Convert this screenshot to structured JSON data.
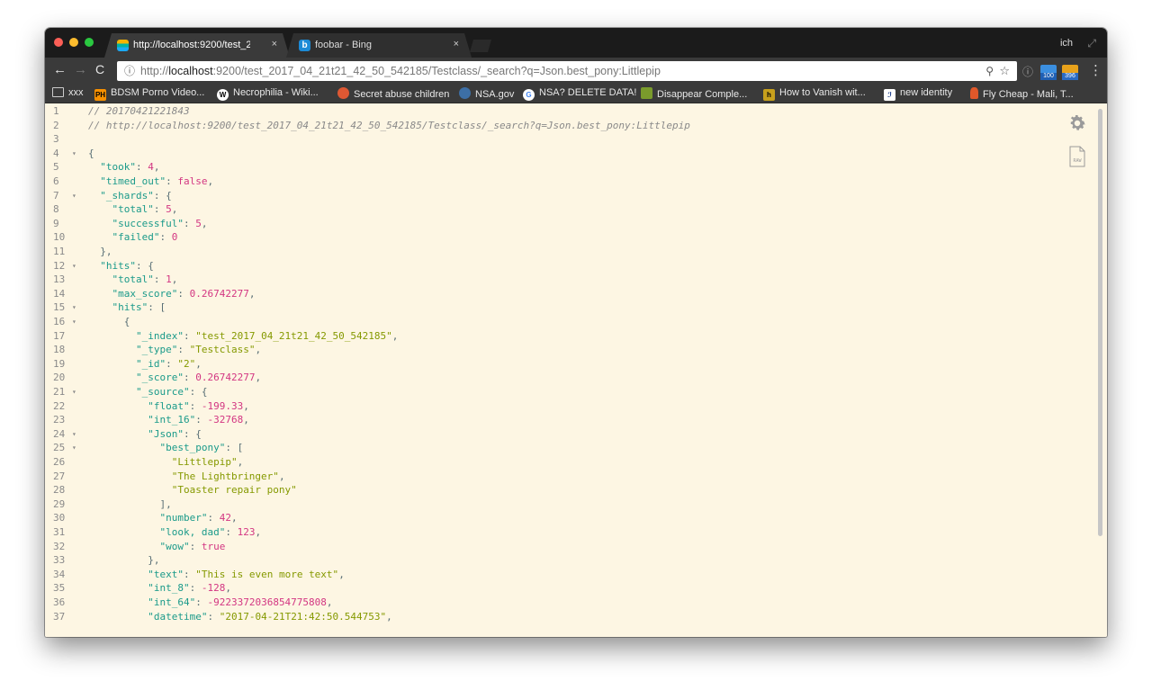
{
  "browser": {
    "tabs": [
      {
        "title": "http://localhost:9200/test_2(",
        "close": "×",
        "active": true
      },
      {
        "title": "foobar - Bing",
        "close": "×",
        "active": false
      }
    ],
    "profile_name": "ich",
    "address": {
      "info_icon": "ⓘ",
      "scheme": "http://",
      "host": "localhost",
      "rest": ":9200/test_2017_04_21t21_42_50_542185/Testclass/_search?q=Json.best_pony:Littlepip"
    },
    "extensions": [
      {
        "name": "ext-badge-100",
        "badge": "100"
      },
      {
        "name": "ext-badge-396",
        "badge": "396"
      }
    ]
  },
  "bookmarks": [
    {
      "label": "xxx",
      "icon": "folder-icon"
    },
    {
      "label": "BDSM Porno Video...",
      "icon": "pornhub-icon",
      "glyph": "PH"
    },
    {
      "label": "Necrophilia - Wiki...",
      "icon": "wikipedia-icon",
      "glyph": "W"
    },
    {
      "label": "Secret abuse children",
      "icon": "duckduckgo-icon",
      "glyph": ""
    },
    {
      "label": "NSA.gov",
      "icon": "nsa-icon",
      "glyph": ""
    },
    {
      "label": "NSA? DELETE DATA!",
      "icon": "google-icon",
      "glyph": "G"
    },
    {
      "label": "Disappear Comple...",
      "icon": "disappear-icon",
      "glyph": ""
    },
    {
      "label": "How to Vanish wit...",
      "icon": "vanish-icon",
      "glyph": "h"
    },
    {
      "label": "new identity",
      "icon": "signature-icon",
      "glyph": "ℐ"
    },
    {
      "label": "Fly Cheap - Mali, T...",
      "icon": "flycheap-icon",
      "glyph": ""
    }
  ],
  "code_lines": [
    {
      "n": "1",
      "fold": "",
      "tokens": [
        [
          "cm",
          "// 20170421221843"
        ]
      ]
    },
    {
      "n": "2",
      "fold": "",
      "tokens": [
        [
          "cm",
          "// http://localhost:9200/test_2017_04_21t21_42_50_542185/Testclass/_search?q=Json.best_pony:Littlepip"
        ]
      ]
    },
    {
      "n": "3",
      "fold": "",
      "tokens": []
    },
    {
      "n": "4",
      "fold": "▾",
      "tokens": [
        [
          "p",
          "{"
        ]
      ]
    },
    {
      "n": "5",
      "fold": "",
      "tokens": [
        [
          "p",
          "  "
        ],
        [
          "k",
          "\"took\""
        ],
        [
          "p",
          ": "
        ],
        [
          "n",
          "4"
        ],
        [
          "p",
          ","
        ]
      ]
    },
    {
      "n": "6",
      "fold": "",
      "tokens": [
        [
          "p",
          "  "
        ],
        [
          "k",
          "\"timed_out\""
        ],
        [
          "p",
          ": "
        ],
        [
          "b",
          "false"
        ],
        [
          "p",
          ","
        ]
      ]
    },
    {
      "n": "7",
      "fold": "▾",
      "tokens": [
        [
          "p",
          "  "
        ],
        [
          "k",
          "\"_shards\""
        ],
        [
          "p",
          ": {"
        ]
      ]
    },
    {
      "n": "8",
      "fold": "",
      "tokens": [
        [
          "p",
          "    "
        ],
        [
          "k",
          "\"total\""
        ],
        [
          "p",
          ": "
        ],
        [
          "n",
          "5"
        ],
        [
          "p",
          ","
        ]
      ]
    },
    {
      "n": "9",
      "fold": "",
      "tokens": [
        [
          "p",
          "    "
        ],
        [
          "k",
          "\"successful\""
        ],
        [
          "p",
          ": "
        ],
        [
          "n",
          "5"
        ],
        [
          "p",
          ","
        ]
      ]
    },
    {
      "n": "10",
      "fold": "",
      "tokens": [
        [
          "p",
          "    "
        ],
        [
          "k",
          "\"failed\""
        ],
        [
          "p",
          ": "
        ],
        [
          "n",
          "0"
        ]
      ]
    },
    {
      "n": "11",
      "fold": "",
      "tokens": [
        [
          "p",
          "  },"
        ]
      ]
    },
    {
      "n": "12",
      "fold": "▾",
      "tokens": [
        [
          "p",
          "  "
        ],
        [
          "k",
          "\"hits\""
        ],
        [
          "p",
          ": {"
        ]
      ]
    },
    {
      "n": "13",
      "fold": "",
      "tokens": [
        [
          "p",
          "    "
        ],
        [
          "k",
          "\"total\""
        ],
        [
          "p",
          ": "
        ],
        [
          "n",
          "1"
        ],
        [
          "p",
          ","
        ]
      ]
    },
    {
      "n": "14",
      "fold": "",
      "tokens": [
        [
          "p",
          "    "
        ],
        [
          "k",
          "\"max_score\""
        ],
        [
          "p",
          ": "
        ],
        [
          "n",
          "0.26742277"
        ],
        [
          "p",
          ","
        ]
      ]
    },
    {
      "n": "15",
      "fold": "▾",
      "tokens": [
        [
          "p",
          "    "
        ],
        [
          "k",
          "\"hits\""
        ],
        [
          "p",
          ": ["
        ]
      ]
    },
    {
      "n": "16",
      "fold": "▾",
      "tokens": [
        [
          "p",
          "      {"
        ]
      ]
    },
    {
      "n": "17",
      "fold": "",
      "tokens": [
        [
          "p",
          "        "
        ],
        [
          "k",
          "\"_index\""
        ],
        [
          "p",
          ": "
        ],
        [
          "s",
          "\"test_2017_04_21t21_42_50_542185\""
        ],
        [
          "p",
          ","
        ]
      ]
    },
    {
      "n": "18",
      "fold": "",
      "tokens": [
        [
          "p",
          "        "
        ],
        [
          "k",
          "\"_type\""
        ],
        [
          "p",
          ": "
        ],
        [
          "s",
          "\"Testclass\""
        ],
        [
          "p",
          ","
        ]
      ]
    },
    {
      "n": "19",
      "fold": "",
      "tokens": [
        [
          "p",
          "        "
        ],
        [
          "k",
          "\"_id\""
        ],
        [
          "p",
          ": "
        ],
        [
          "s",
          "\"2\""
        ],
        [
          "p",
          ","
        ]
      ]
    },
    {
      "n": "20",
      "fold": "",
      "tokens": [
        [
          "p",
          "        "
        ],
        [
          "k",
          "\"_score\""
        ],
        [
          "p",
          ": "
        ],
        [
          "n",
          "0.26742277"
        ],
        [
          "p",
          ","
        ]
      ]
    },
    {
      "n": "21",
      "fold": "▾",
      "tokens": [
        [
          "p",
          "        "
        ],
        [
          "k",
          "\"_source\""
        ],
        [
          "p",
          ": {"
        ]
      ]
    },
    {
      "n": "22",
      "fold": "",
      "tokens": [
        [
          "p",
          "          "
        ],
        [
          "k",
          "\"float\""
        ],
        [
          "p",
          ": "
        ],
        [
          "n",
          "-199.33"
        ],
        [
          "p",
          ","
        ]
      ]
    },
    {
      "n": "23",
      "fold": "",
      "tokens": [
        [
          "p",
          "          "
        ],
        [
          "k",
          "\"int_16\""
        ],
        [
          "p",
          ": "
        ],
        [
          "n",
          "-32768"
        ],
        [
          "p",
          ","
        ]
      ]
    },
    {
      "n": "24",
      "fold": "▾",
      "tokens": [
        [
          "p",
          "          "
        ],
        [
          "k",
          "\"Json\""
        ],
        [
          "p",
          ": {"
        ]
      ]
    },
    {
      "n": "25",
      "fold": "▾",
      "tokens": [
        [
          "p",
          "            "
        ],
        [
          "k",
          "\"best_pony\""
        ],
        [
          "p",
          ": ["
        ]
      ]
    },
    {
      "n": "26",
      "fold": "",
      "tokens": [
        [
          "p",
          "              "
        ],
        [
          "s",
          "\"Littlepip\""
        ],
        [
          "p",
          ","
        ]
      ]
    },
    {
      "n": "27",
      "fold": "",
      "tokens": [
        [
          "p",
          "              "
        ],
        [
          "s",
          "\"The Lightbringer\""
        ],
        [
          "p",
          ","
        ]
      ]
    },
    {
      "n": "28",
      "fold": "",
      "tokens": [
        [
          "p",
          "              "
        ],
        [
          "s",
          "\"Toaster repair pony\""
        ]
      ]
    },
    {
      "n": "29",
      "fold": "",
      "tokens": [
        [
          "p",
          "            ],"
        ]
      ]
    },
    {
      "n": "30",
      "fold": "",
      "tokens": [
        [
          "p",
          "            "
        ],
        [
          "k",
          "\"number\""
        ],
        [
          "p",
          ": "
        ],
        [
          "n",
          "42"
        ],
        [
          "p",
          ","
        ]
      ]
    },
    {
      "n": "31",
      "fold": "",
      "tokens": [
        [
          "p",
          "            "
        ],
        [
          "k",
          "\"look, dad\""
        ],
        [
          "p",
          ": "
        ],
        [
          "n",
          "123"
        ],
        [
          "p",
          ","
        ]
      ]
    },
    {
      "n": "32",
      "fold": "",
      "tokens": [
        [
          "p",
          "            "
        ],
        [
          "k",
          "\"wow\""
        ],
        [
          "p",
          ": "
        ],
        [
          "b",
          "true"
        ]
      ]
    },
    {
      "n": "33",
      "fold": "",
      "tokens": [
        [
          "p",
          "          },"
        ]
      ]
    },
    {
      "n": "34",
      "fold": "",
      "tokens": [
        [
          "p",
          "          "
        ],
        [
          "k",
          "\"text\""
        ],
        [
          "p",
          ": "
        ],
        [
          "s",
          "\"This is even more text\""
        ],
        [
          "p",
          ","
        ]
      ]
    },
    {
      "n": "35",
      "fold": "",
      "tokens": [
        [
          "p",
          "          "
        ],
        [
          "k",
          "\"int_8\""
        ],
        [
          "p",
          ": "
        ],
        [
          "n",
          "-128"
        ],
        [
          "p",
          ","
        ]
      ]
    },
    {
      "n": "36",
      "fold": "",
      "tokens": [
        [
          "p",
          "          "
        ],
        [
          "k",
          "\"int_64\""
        ],
        [
          "p",
          ": "
        ],
        [
          "n",
          "-9223372036854775808"
        ],
        [
          "p",
          ","
        ]
      ]
    },
    {
      "n": "37",
      "fold": "",
      "tokens": [
        [
          "p",
          "          "
        ],
        [
          "k",
          "\"datetime\""
        ],
        [
          "p",
          ": "
        ],
        [
          "s",
          "\"2017-04-21T21:42:50.544753\""
        ],
        [
          "p",
          ","
        ]
      ]
    }
  ],
  "side_tools": [
    {
      "name": "settings-gear-icon"
    },
    {
      "name": "raw-view-icon",
      "label": "RAW"
    }
  ],
  "colors": {
    "editor_bg": "#fdf6e3",
    "key": "#1a9a8a",
    "string": "#859900",
    "number": "#d33682",
    "comment": "#8a8a8a"
  }
}
